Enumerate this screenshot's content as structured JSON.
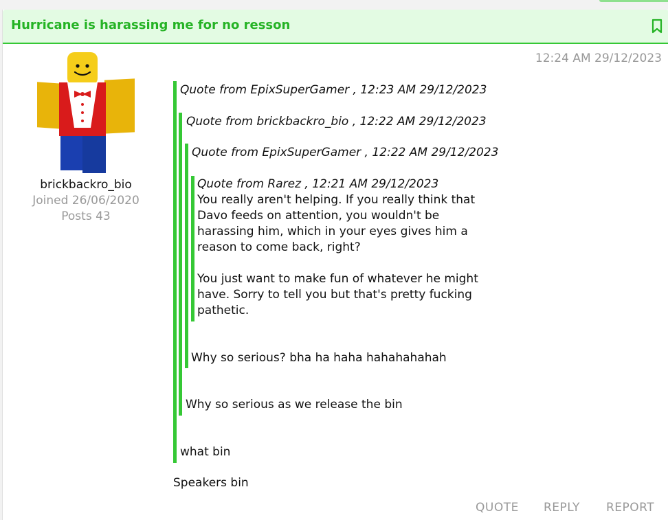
{
  "post": {
    "title": "Hurricane is harassing me for no resson",
    "timestamp": "12:24 AM 29/12/2023"
  },
  "author": {
    "username": "brickbackro_bio",
    "joined": "Joined 26/06/2020",
    "posts": "Posts 43"
  },
  "quotes": {
    "q1_header": "Quote from EpixSuperGamer , 12:23 AM 29/12/2023",
    "q2_header": "Quote from brickbackro_bio , 12:22 AM 29/12/2023",
    "q3_header": "Quote from EpixSuperGamer , 12:22 AM 29/12/2023",
    "q4_header": "Quote from Rarez , 12:21 AM 29/12/2023",
    "q4_lines": [
      "You really aren't helping. If you really think that",
      "Davo feeds on attention, you wouldn't be",
      "harassing him, which in your eyes gives him a",
      "reason to come back, right?",
      "You just want to make fun of whatever he might",
      "have. Sorry to tell you but that's pretty fucking",
      "pathetic."
    ],
    "q3_reply": "Why so serious? bha ha haha hahahahahah",
    "q2_reply": "Why so serious as we release the bin",
    "q1_reply": "what bin"
  },
  "body": "Speakers bin",
  "actions": {
    "quote": "QUOTE",
    "reply": "REPLY",
    "report": "REPORT"
  },
  "icons": {
    "bookmark": "bookmark-icon",
    "avatar": "roblox-avatar"
  },
  "colors": {
    "accent": "#35c835",
    "title": "#25b325",
    "header_bg": "#e3fbe3",
    "muted": "#999999"
  }
}
